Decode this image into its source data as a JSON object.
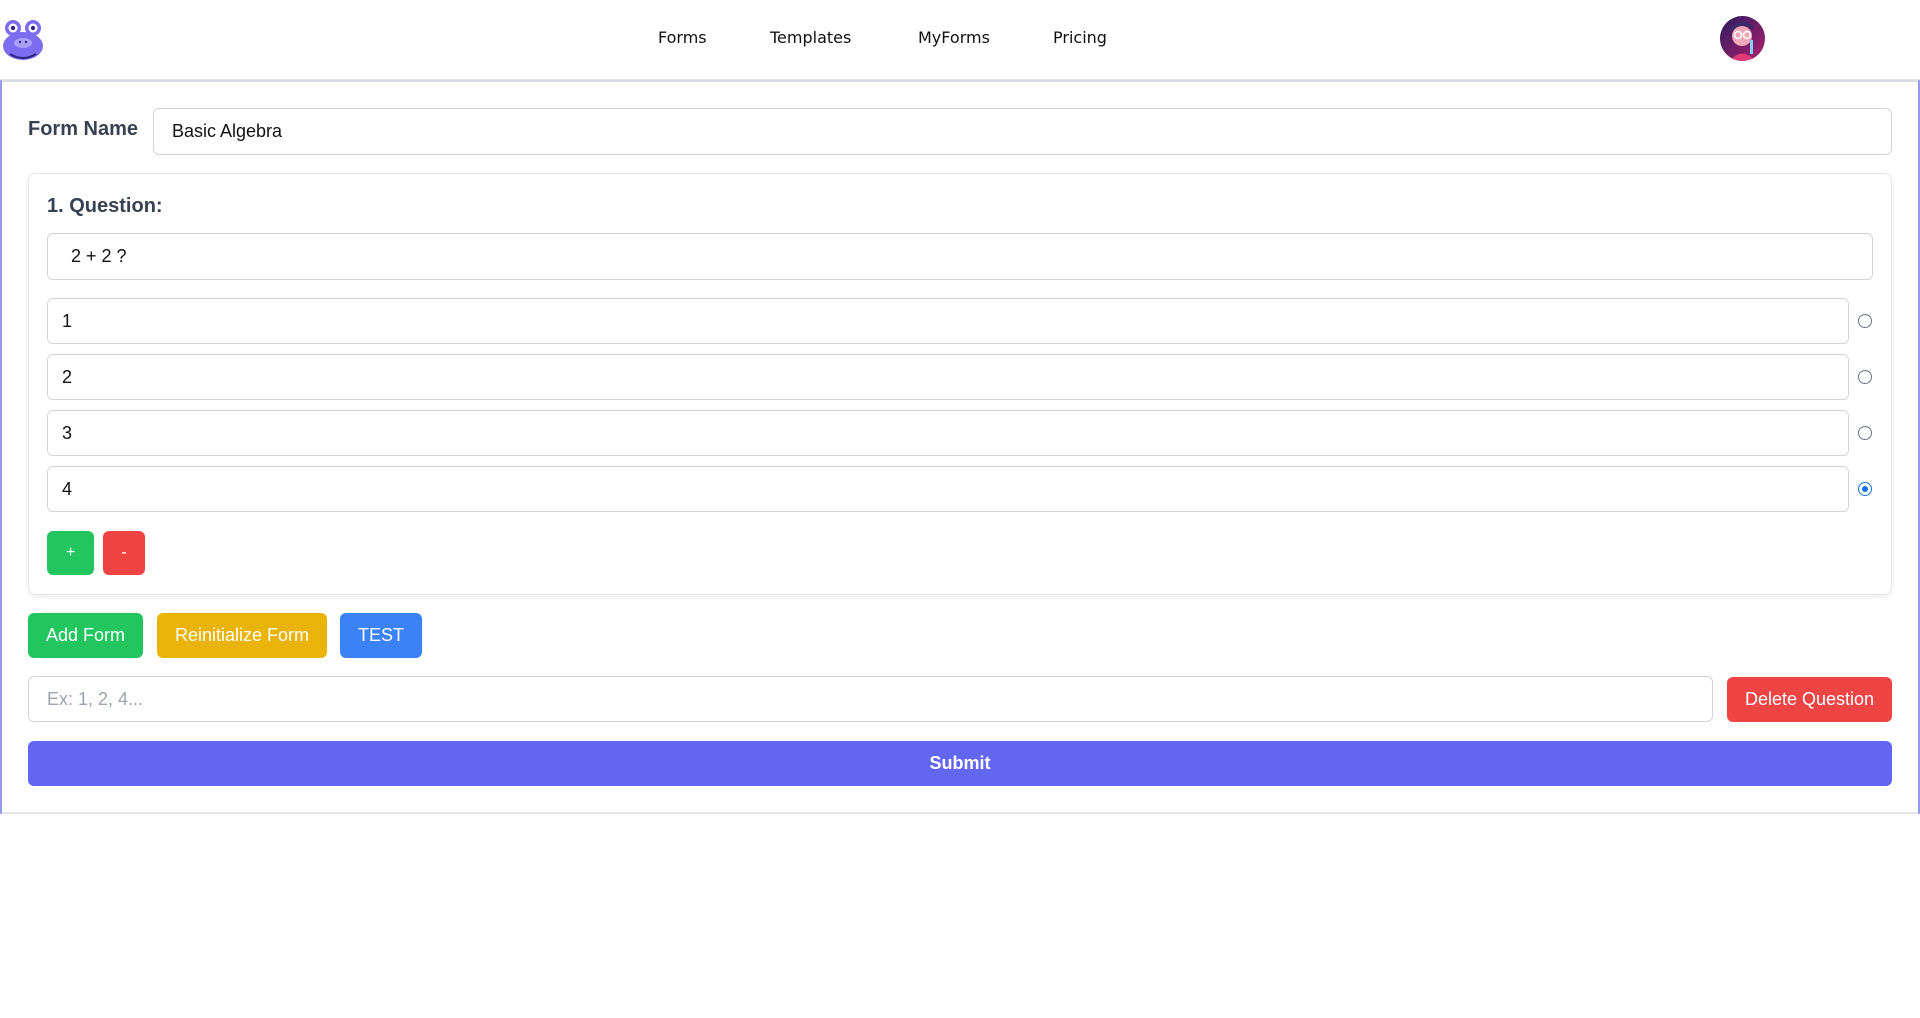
{
  "nav": {
    "links": [
      "Forms",
      "Templates",
      "MyForms",
      "Pricing"
    ]
  },
  "form": {
    "name_label": "Form Name",
    "name_value": "Basic Algebra"
  },
  "question": {
    "title": "1. Question:",
    "text": " 2 + 2 ?",
    "options": [
      "1",
      "2",
      "3",
      "4"
    ],
    "selected_option": "4",
    "add_option_label": "+",
    "remove_option_label": "-"
  },
  "actions": {
    "add_form": "Add Form",
    "reinitialize_form": "Reinitialize Form",
    "test": "TEST"
  },
  "delete": {
    "placeholder": "Ex: 1, 2, 4...",
    "button": "Delete Question"
  },
  "submit": "Submit",
  "colors": {
    "brand": "#6366f1",
    "green": "#22c55e",
    "red": "#ef4444",
    "yellow": "#eab308",
    "blue": "#3b82f6"
  }
}
